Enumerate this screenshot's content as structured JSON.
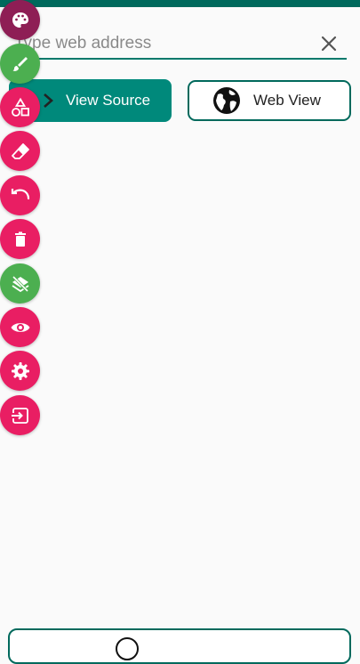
{
  "address_bar": {
    "placeholder": "Type web address",
    "value": ""
  },
  "buttons": {
    "view_source": "View Source",
    "web_view": "Web View"
  },
  "toolbar": [
    {
      "icon": "palette-icon",
      "color": "#8e1e55"
    },
    {
      "icon": "brush-icon",
      "color": "#4caf50"
    },
    {
      "icon": "shapes-icon",
      "color": "#e91e63"
    },
    {
      "icon": "eraser-icon",
      "color": "#e91e63"
    },
    {
      "icon": "undo-icon",
      "color": "#e91e63"
    },
    {
      "icon": "trash-icon",
      "color": "#e91e63"
    },
    {
      "icon": "layers-off-icon",
      "color": "#4caf50"
    },
    {
      "icon": "eye-icon",
      "color": "#e91e63"
    },
    {
      "icon": "gear-icon",
      "color": "#e91e63"
    },
    {
      "icon": "exit-icon",
      "color": "#e91e63"
    }
  ],
  "colors": {
    "primary": "#00897b",
    "primary_dark": "#00695c",
    "accent": "#e91e63",
    "green": "#4caf50"
  }
}
